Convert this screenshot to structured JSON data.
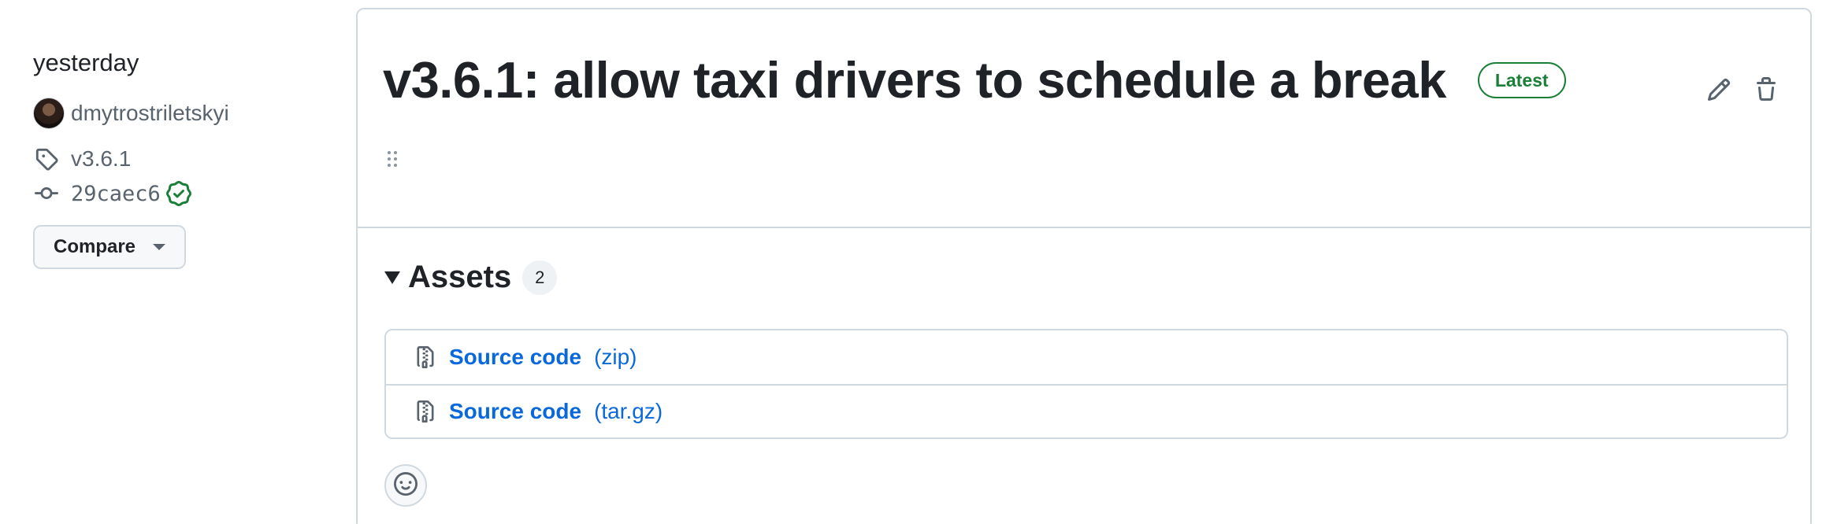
{
  "meta": {
    "date": "yesterday",
    "author": "dmytrostriletskyi",
    "tag": "v3.6.1",
    "commit": "29caec6",
    "compare_label": "Compare"
  },
  "release": {
    "title": "v3.6.1: allow taxi drivers to schedule a break",
    "badge": "Latest"
  },
  "assets": {
    "title": "Assets",
    "count": "2",
    "items": [
      {
        "name": "Source code",
        "ext": "(zip)"
      },
      {
        "name": "Source code",
        "ext": "(tar.gz)"
      }
    ]
  },
  "icons": {
    "tag": "tag-icon",
    "commit": "git-commit-icon",
    "verified": "verified-icon",
    "edit": "pencil-icon",
    "delete": "trash-icon",
    "file_zip": "file-zip-icon",
    "reaction": "smiley-icon"
  },
  "colors": {
    "link": "#0969da",
    "latest_badge": "#1a7f37",
    "border": "#d1d9e0",
    "muted_text": "#59636e"
  }
}
